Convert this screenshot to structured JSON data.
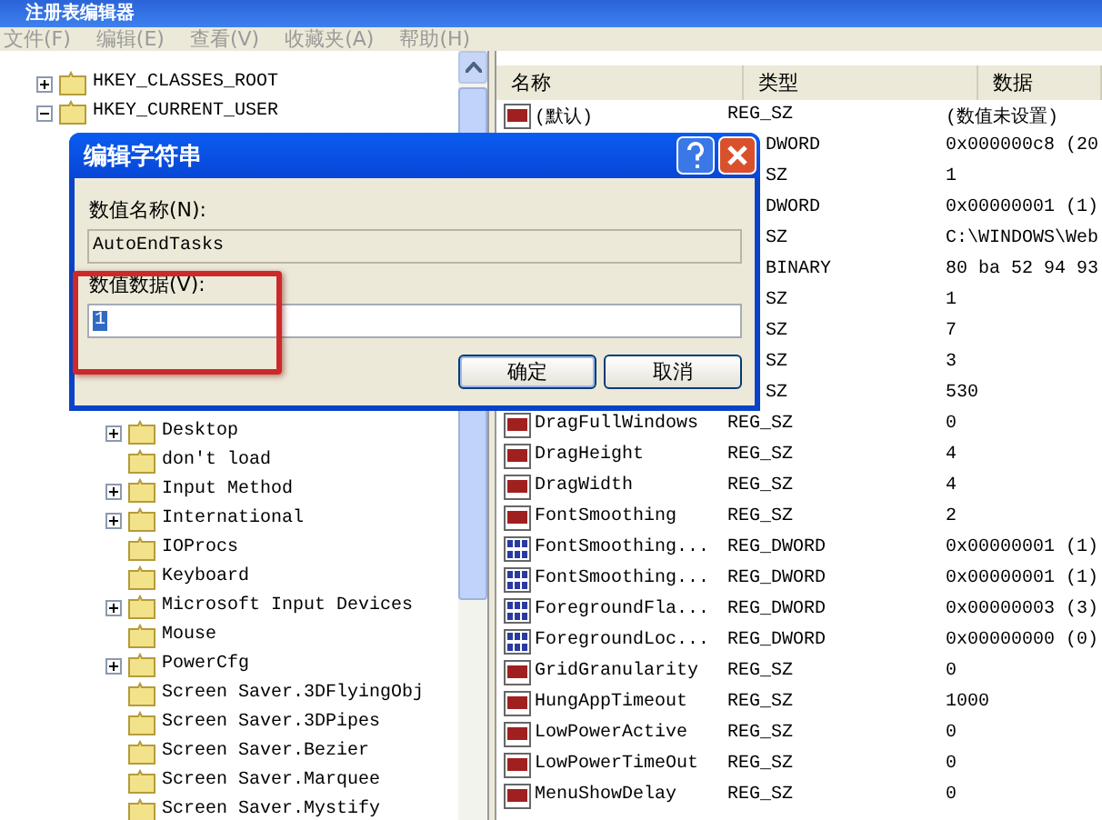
{
  "window": {
    "title": "注册表编辑器"
  },
  "menu": [
    "文件(F)",
    "编辑(E)",
    "查看(V)",
    "收藏夹(A)",
    "帮助(H)"
  ],
  "tree": [
    {
      "label": "HKEY_CLASSES_ROOT",
      "expanded": false,
      "kind": "branch"
    },
    {
      "label": "HKEY_CURRENT_USER",
      "expanded": true,
      "kind": "branch",
      "children": [
        {
          "kind": "covered",
          "children": [
            {
              "label": "Desktop",
              "kind": "branch",
              "expanded": false
            },
            {
              "label": "don't load",
              "kind": "leaf"
            },
            {
              "label": "Input Method",
              "kind": "branch",
              "expanded": false
            },
            {
              "label": "International",
              "kind": "branch",
              "expanded": false
            },
            {
              "label": "IOProcs",
              "kind": "leaf"
            },
            {
              "label": "Keyboard",
              "kind": "leaf"
            },
            {
              "label": "Microsoft Input Devices",
              "kind": "branch",
              "expanded": false
            },
            {
              "label": "Mouse",
              "kind": "leaf"
            },
            {
              "label": "PowerCfg",
              "kind": "branch",
              "expanded": false
            },
            {
              "label": "Screen Saver.3DFlyingObj",
              "kind": "leaf"
            },
            {
              "label": "Screen Saver.3DPipes",
              "kind": "leaf"
            },
            {
              "label": "Screen Saver.Bezier",
              "kind": "leaf"
            },
            {
              "label": "Screen Saver.Marquee",
              "kind": "leaf"
            },
            {
              "label": "Screen Saver.Mystify",
              "kind": "leaf"
            }
          ]
        }
      ]
    }
  ],
  "columns": [
    "名称",
    "类型",
    "数据"
  ],
  "rows": [
    {
      "kind": "string",
      "name": "(默认)",
      "type": "REG_SZ",
      "data": "(数值未设置)"
    },
    {
      "kind": "covered",
      "type": "DWORD",
      "data": "0x000000c8 (20"
    },
    {
      "kind": "covered",
      "type": "SZ",
      "data": "1"
    },
    {
      "kind": "covered",
      "type": "DWORD",
      "data": "0x00000001 (1)"
    },
    {
      "kind": "covered",
      "type": "SZ",
      "data": "C:\\WINDOWS\\Web"
    },
    {
      "kind": "covered",
      "type": "BINARY",
      "data": "80 ba 52 94 93"
    },
    {
      "kind": "covered",
      "type": "SZ",
      "data": "1"
    },
    {
      "kind": "covered",
      "type": "SZ",
      "data": "7"
    },
    {
      "kind": "covered",
      "type": "SZ",
      "data": "3"
    },
    {
      "kind": "covered",
      "type": "SZ",
      "data": "530"
    },
    {
      "kind": "string",
      "name": "DragFullWindows",
      "type": "REG_SZ",
      "data": "0"
    },
    {
      "kind": "string",
      "name": "DragHeight",
      "type": "REG_SZ",
      "data": "4"
    },
    {
      "kind": "string",
      "name": "DragWidth",
      "type": "REG_SZ",
      "data": "4"
    },
    {
      "kind": "string",
      "name": "FontSmoothing",
      "type": "REG_SZ",
      "data": "2"
    },
    {
      "kind": "dword",
      "name": "FontSmoothing...",
      "type": "REG_DWORD",
      "data": "0x00000001 (1)"
    },
    {
      "kind": "dword",
      "name": "FontSmoothing...",
      "type": "REG_DWORD",
      "data": "0x00000001 (1)"
    },
    {
      "kind": "dword",
      "name": "ForegroundFla...",
      "type": "REG_DWORD",
      "data": "0x00000003 (3)"
    },
    {
      "kind": "dword",
      "name": "ForegroundLoc...",
      "type": "REG_DWORD",
      "data": "0x00000000 (0)"
    },
    {
      "kind": "string",
      "name": "GridGranularity",
      "type": "REG_SZ",
      "data": "0"
    },
    {
      "kind": "string",
      "name": "HungAppTimeout",
      "type": "REG_SZ",
      "data": "1000"
    },
    {
      "kind": "string",
      "name": "LowPowerActive",
      "type": "REG_SZ",
      "data": "0"
    },
    {
      "kind": "string",
      "name": "LowPowerTimeOut",
      "type": "REG_SZ",
      "data": "0"
    },
    {
      "kind": "string",
      "name": "MenuShowDelay",
      "type": "REG_SZ",
      "data": "0"
    }
  ],
  "dialog": {
    "title": "编辑字符串",
    "name_label": "数值名称(N):",
    "name_value": "AutoEndTasks",
    "data_label": "数值数据(V):",
    "data_value": "1",
    "data_selected": true,
    "buttons": [
      {
        "label": "确定",
        "default": true
      },
      {
        "label": "取消",
        "default": false
      }
    ]
  }
}
